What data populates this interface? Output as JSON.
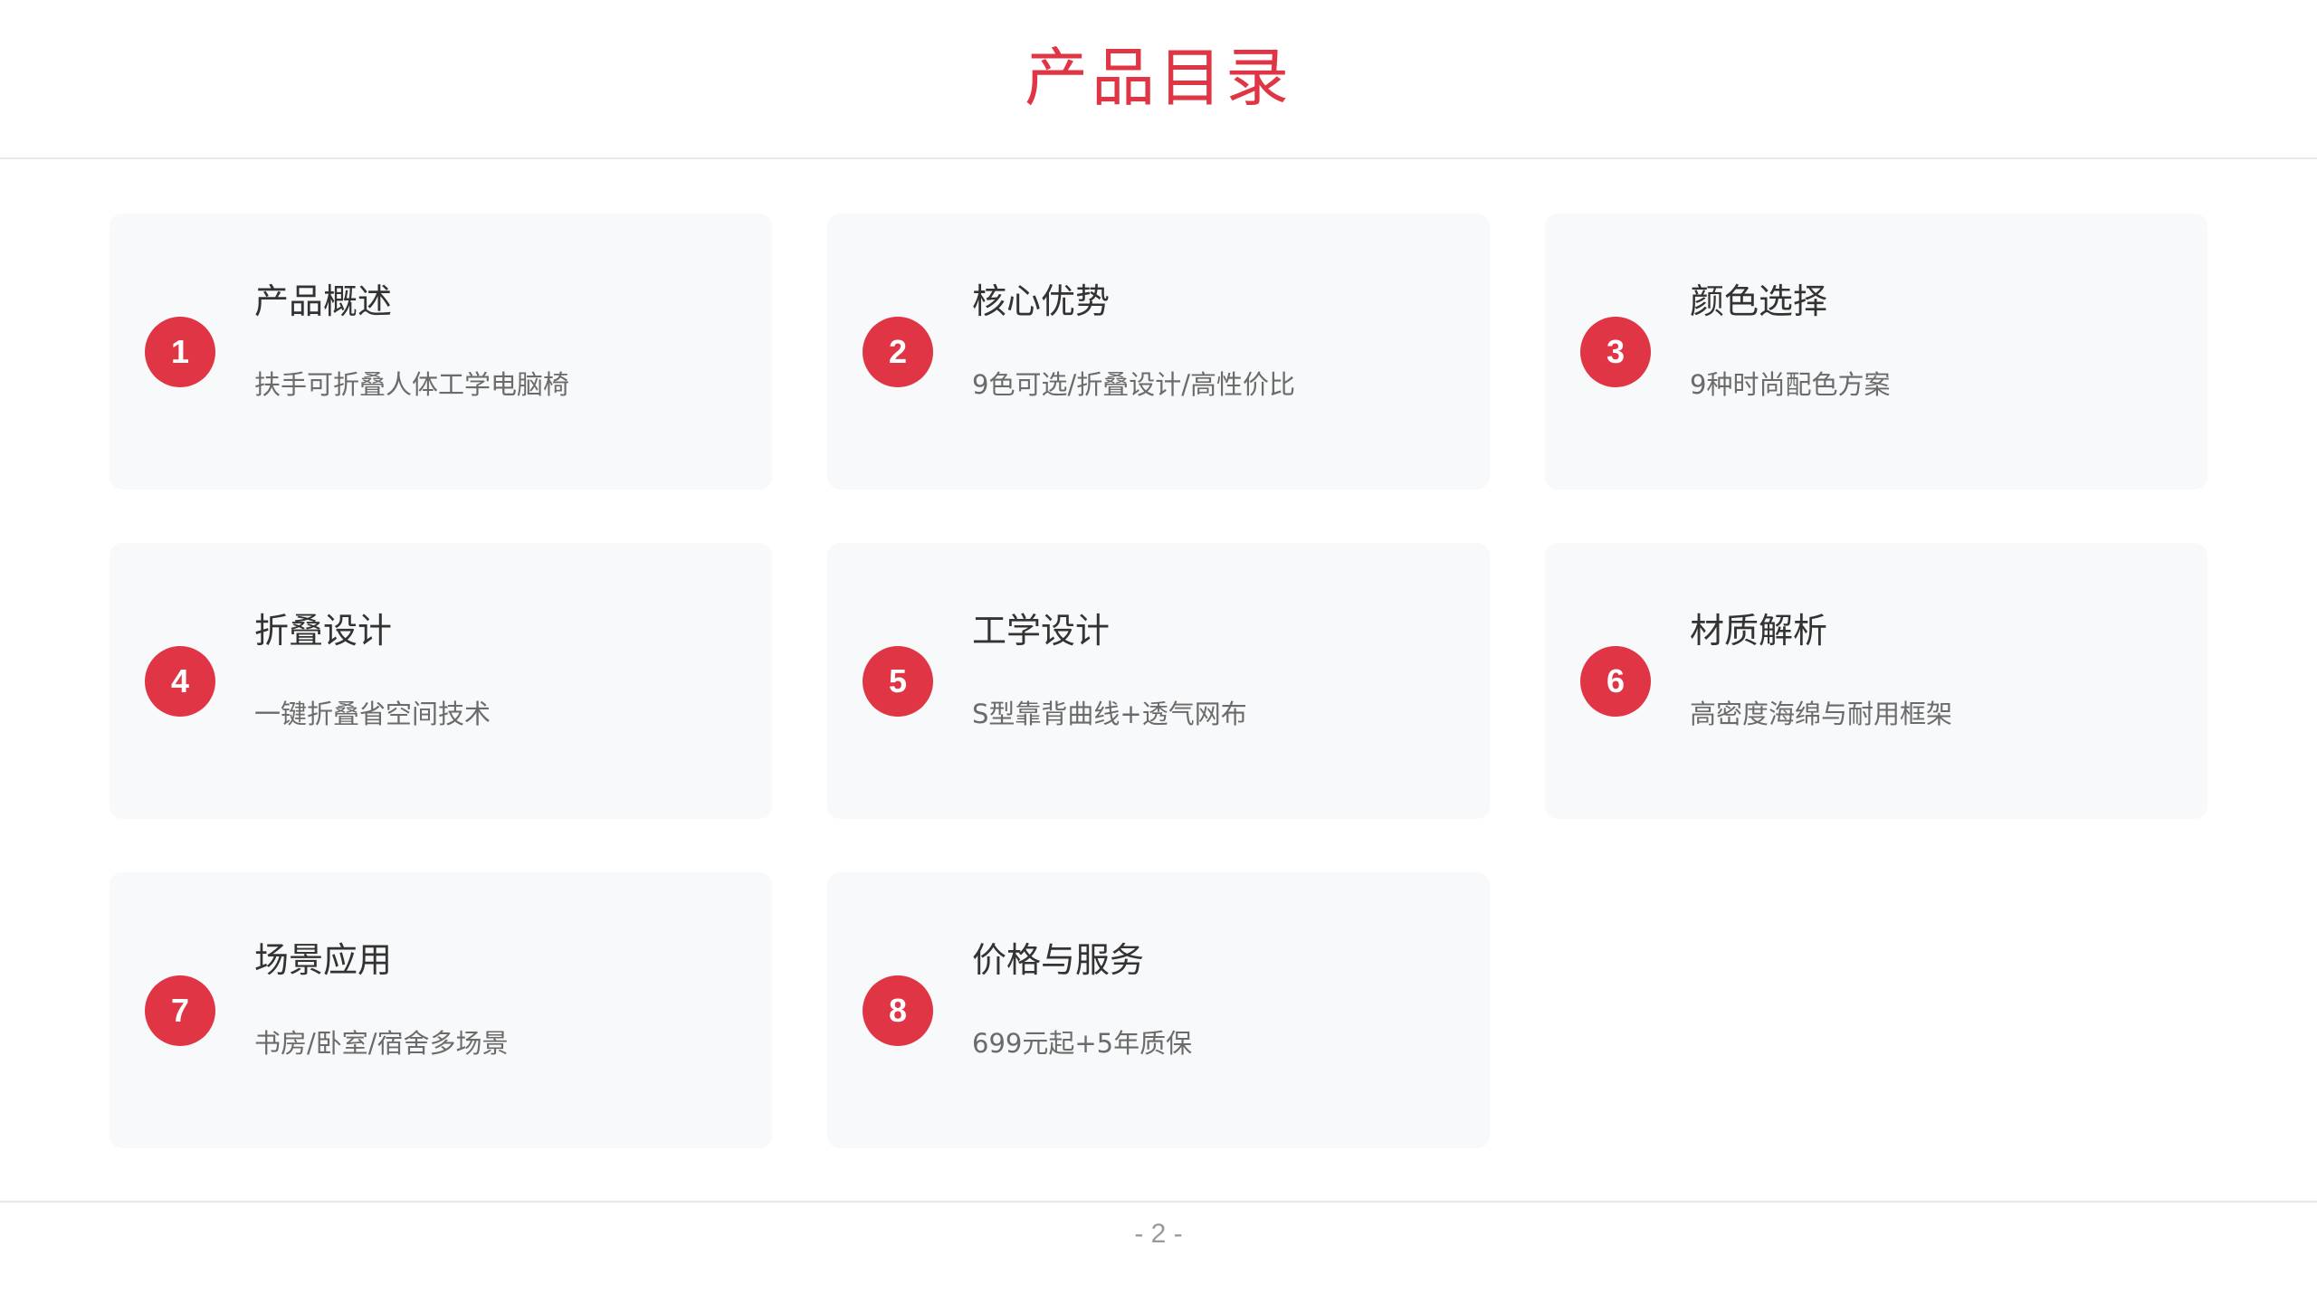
{
  "header": {
    "title": "产品目录"
  },
  "items": [
    {
      "number": "1",
      "title": "产品概述",
      "desc": "扶手可折叠人体工学电脑椅"
    },
    {
      "number": "2",
      "title": "核心优势",
      "desc": "9色可选/折叠设计/高性价比"
    },
    {
      "number": "3",
      "title": "颜色选择",
      "desc": "9种时尚配色方案"
    },
    {
      "number": "4",
      "title": "折叠设计",
      "desc": "一键折叠省空间技术"
    },
    {
      "number": "5",
      "title": "工学设计",
      "desc": "S型靠背曲线+透气网布"
    },
    {
      "number": "6",
      "title": "材质解析",
      "desc": "高密度海绵与耐用框架"
    },
    {
      "number": "7",
      "title": "场景应用",
      "desc": "书房/卧室/宿舍多场景"
    },
    {
      "number": "8",
      "title": "价格与服务",
      "desc": "699元起+5年质保"
    }
  ],
  "footer": {
    "page_number": "- 2 -"
  },
  "colors": {
    "accent": "#e03545",
    "card_bg": "#f8f9fa"
  }
}
